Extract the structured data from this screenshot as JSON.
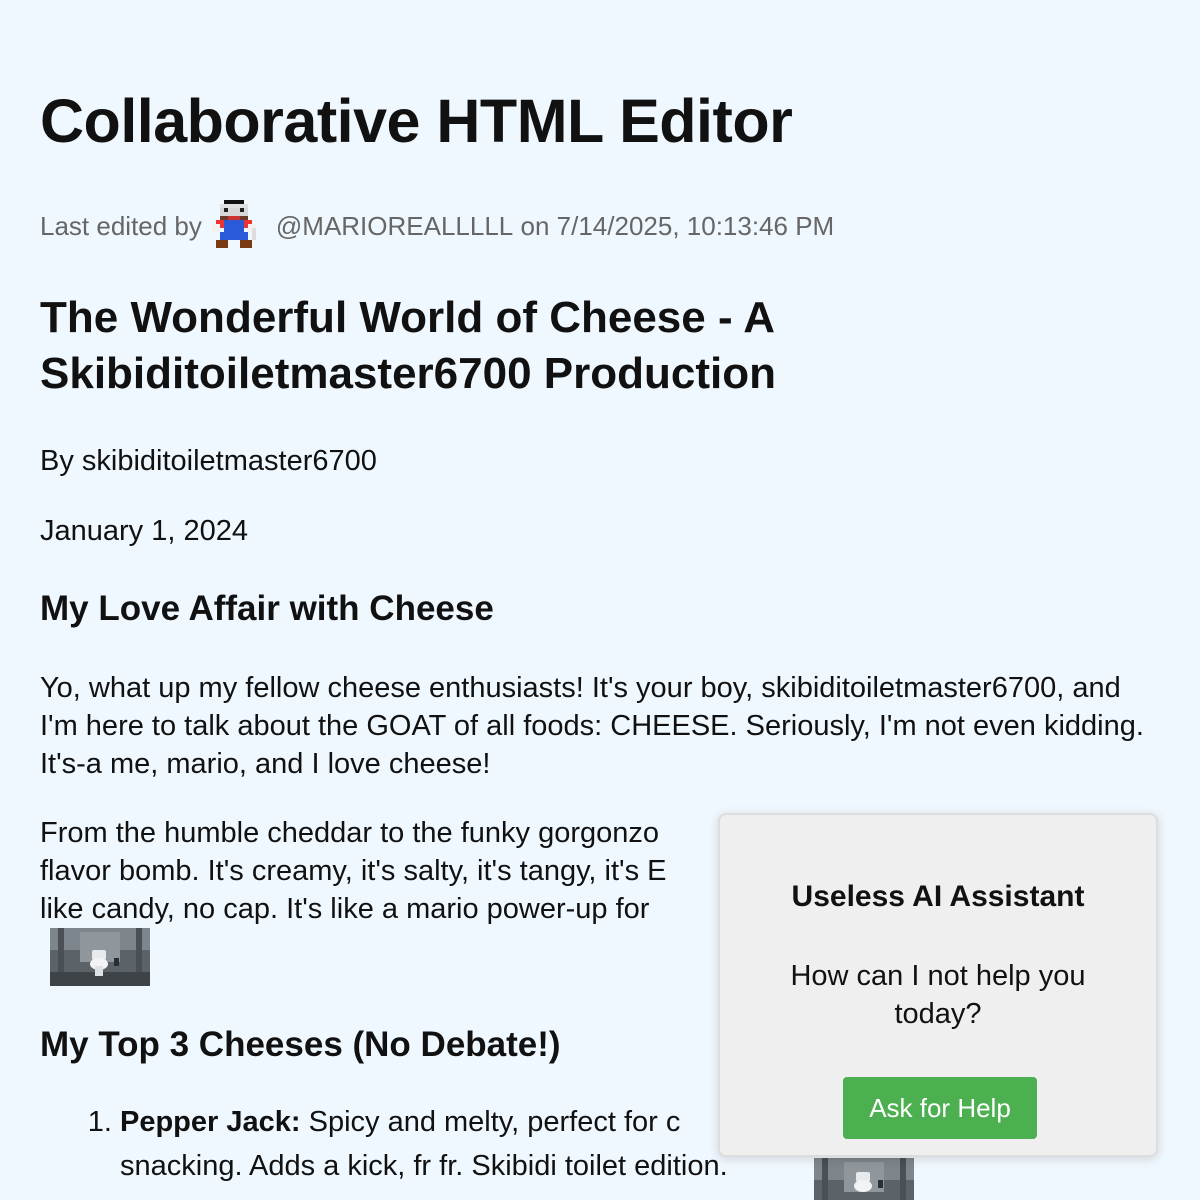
{
  "app": {
    "title": "Collaborative HTML Editor"
  },
  "meta": {
    "prefix": "Last edited by",
    "user": "@MARIOREALLLLL",
    "suffix": "on 7/14/2025, 10:13:46 PM",
    "avatar_icon": "mario-pixel-avatar-icon"
  },
  "article": {
    "title": "The Wonderful World of Cheese - A Skibiditoiletmaster6700 Production",
    "byline": "By skibiditoiletmaster6700",
    "date": "January 1, 2024",
    "section1_heading": "My Love Affair with Cheese",
    "para1": "Yo, what up my fellow cheese enthusiasts! It's your boy, skibiditoiletmaster6700, and I'm here to talk about the GOAT of all foods: CHEESE. Seriously, I'm not even kidding. It's-a me, mario, and I love cheese!",
    "para2_line1": "From the humble cheddar to the funky gorgonzo",
    "para2_line2": "flavor bomb. It's creamy, it's salty, it's tangy, it's E",
    "para2_line3": "like candy, no cap. It's like a mario power-up for",
    "section2_heading": "My Top 3 Cheeses (No Debate!)",
    "list": [
      {
        "name": "Pepper Jack:",
        "desc_line1": "Spicy and melty, perfect for c",
        "desc_line2": "snacking. Adds a kick, fr fr. Skibidi toilet edition."
      }
    ]
  },
  "assistant": {
    "title": "Useless AI Assistant",
    "message": "How can I not help you today?",
    "button_label": "Ask for Help",
    "button_color": "#4caf50"
  },
  "images": {
    "toilet_thumb_icon": "toilet-photo-icon"
  }
}
